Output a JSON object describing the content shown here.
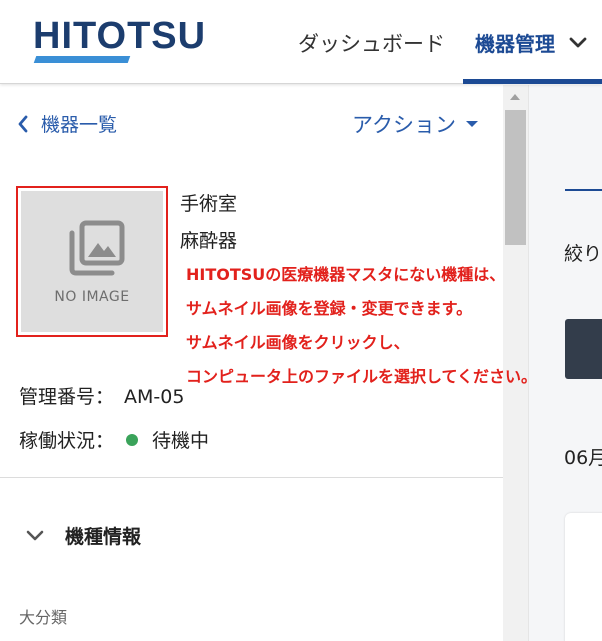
{
  "header": {
    "logo": "HITOTSU",
    "nav": {
      "dashboard": "ダッシュボード",
      "device_management": "機器管理"
    }
  },
  "toolbar": {
    "back_label": "機器一覧",
    "action_label": "アクション"
  },
  "device": {
    "thumbnail_placeholder": "NO IMAGE",
    "room": "手術室",
    "category": "麻酔器",
    "management_number_label": "管理番号：",
    "management_number": "AM-05",
    "status_label": "稼働状況：",
    "status_value": "待機中",
    "status_color": "#3aa35a"
  },
  "annotation": {
    "lines": [
      "HITOTSUの医療機器マスタにない機種は、",
      "サムネイル画像を登録・変更できます。",
      "サムネイル画像をクリックし、",
      "コンピュータ上のファイルを選択してください。"
    ],
    "color": "#e2211c"
  },
  "model_section": {
    "title": "機種情報",
    "major_category_label": "大分類"
  },
  "right_panel": {
    "text_1": "絞り",
    "text_2": "06月"
  },
  "colors": {
    "brand_navy": "#1c3d6e",
    "link_blue": "#2a5cab",
    "accent_red": "#e2211c"
  }
}
